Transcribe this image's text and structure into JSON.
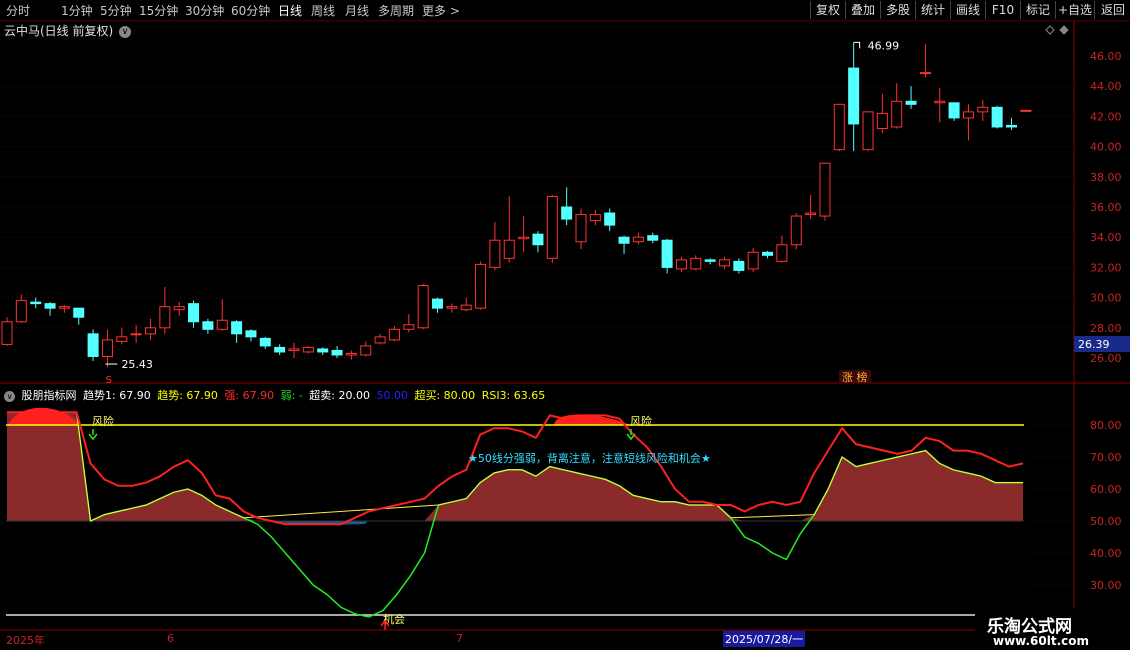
{
  "toolbar": {
    "periods": [
      "分时",
      "1分钟",
      "5分钟",
      "15分钟",
      "30分钟",
      "60分钟",
      "日线",
      "周线",
      "月线",
      "多周期",
      "更多 >"
    ],
    "active_period": "日线",
    "buttons": [
      "复权",
      "叠加",
      "多股",
      "统计",
      "画线",
      "F10",
      "标记",
      "+自选",
      "返回"
    ]
  },
  "main_chart": {
    "title": "云中马(日线 前复权)",
    "high_label": "46.99",
    "low_label": "25.43",
    "price_tag": "26.39",
    "limit_up_tag": "涨 榜",
    "y_ticks": [
      "46.00",
      "44.00",
      "42.00",
      "40.00",
      "38.00",
      "36.00",
      "34.00",
      "32.00",
      "30.00",
      "28.00",
      "26.00"
    ],
    "s_marker": "S"
  },
  "indicator": {
    "name": "股朋指标网",
    "values": [
      {
        "label": "趋势1: 67.90",
        "color": "#ffffff"
      },
      {
        "label": "趋势: 67.90",
        "color": "#ffff00"
      },
      {
        "label": "强: 67.90",
        "color": "#ff2a2a"
      },
      {
        "label": "弱: -",
        "color": "#22dd22"
      },
      {
        "label": "超卖: 20.00",
        "color": "#ffffff"
      },
      {
        "label": "50.00",
        "color": "#2222ff"
      },
      {
        "label": "超买: 80.00",
        "color": "#ffff00"
      },
      {
        "label": "RSI3: 63.65",
        "color": "#ffff00"
      }
    ],
    "y_ticks": [
      "80.00",
      "70.00",
      "60.00",
      "50.00",
      "40.00",
      "30.00"
    ],
    "annotation": "★50线分强弱，背离注意，注意短线风险和机会★",
    "risk_label": "风险",
    "chance_label": "机会"
  },
  "date_axis": {
    "labels": [
      "2025年",
      "6",
      "7"
    ],
    "cursor_date": "2025/07/28/一"
  },
  "watermark": {
    "site": "乐淘公式网",
    "url": "www.60lt.com"
  },
  "chart_data": {
    "type": "candlestick",
    "ylim": [
      25,
      47.5
    ],
    "up_color": "#ff3232",
    "down_color": "#54ffff",
    "candles": [
      [
        26.9,
        28.4,
        26.8,
        28.7
      ],
      [
        28.4,
        29.8,
        28.3,
        30.2
      ],
      [
        29.7,
        29.6,
        29.3,
        30.0
      ],
      [
        29.6,
        29.3,
        28.8,
        29.7
      ],
      [
        29.3,
        29.4,
        29.0,
        29.5
      ],
      [
        29.3,
        28.7,
        28.2,
        29.0
      ],
      [
        27.6,
        26.1,
        25.8,
        27.9
      ],
      [
        26.1,
        27.2,
        25.4,
        27.9
      ],
      [
        27.1,
        27.4,
        26.9,
        28.0
      ],
      [
        27.6,
        27.6,
        27.0,
        28.2
      ],
      [
        27.6,
        28.0,
        27.2,
        28.6
      ],
      [
        28.0,
        29.4,
        27.6,
        30.7
      ],
      [
        29.2,
        29.4,
        28.8,
        29.7
      ],
      [
        29.6,
        28.4,
        28.0,
        29.8
      ],
      [
        28.4,
        27.9,
        27.6,
        28.6
      ],
      [
        27.9,
        28.5,
        27.8,
        29.9
      ],
      [
        28.4,
        27.6,
        27.0,
        28.5
      ],
      [
        27.8,
        27.4,
        27.1,
        27.9
      ],
      [
        27.3,
        26.8,
        26.6,
        27.4
      ],
      [
        26.7,
        26.4,
        26.2,
        26.9
      ],
      [
        26.5,
        26.6,
        26.0,
        27.0
      ],
      [
        26.4,
        26.7,
        26.3,
        26.8
      ],
      [
        26.6,
        26.4,
        26.2,
        26.7
      ],
      [
        26.5,
        26.2,
        26.0,
        26.8
      ],
      [
        26.2,
        26.3,
        25.9,
        26.5
      ],
      [
        26.2,
        26.8,
        26.1,
        27.1
      ],
      [
        27.0,
        27.4,
        26.9,
        27.6
      ],
      [
        27.2,
        27.9,
        27.1,
        28.1
      ],
      [
        27.9,
        28.2,
        27.7,
        28.9
      ],
      [
        28.0,
        30.8,
        27.9,
        30.9
      ],
      [
        29.9,
        29.3,
        29.0,
        30.0
      ],
      [
        29.3,
        29.4,
        29.0,
        29.6
      ],
      [
        29.2,
        29.5,
        29.1,
        30.0
      ],
      [
        29.3,
        32.2,
        29.2,
        32.4
      ],
      [
        32.0,
        33.8,
        31.8,
        35.0
      ],
      [
        32.6,
        33.8,
        32.3,
        36.7
      ],
      [
        33.9,
        34.0,
        33.0,
        35.4
      ],
      [
        34.2,
        33.5,
        33.0,
        34.4
      ],
      [
        32.6,
        36.7,
        32.3,
        36.8
      ],
      [
        36.0,
        35.2,
        34.8,
        37.3
      ],
      [
        33.7,
        35.5,
        33.2,
        35.9
      ],
      [
        35.1,
        35.5,
        34.8,
        35.8
      ],
      [
        35.6,
        34.8,
        34.4,
        35.9
      ],
      [
        34.0,
        33.6,
        32.9,
        34.1
      ],
      [
        33.7,
        34.0,
        33.5,
        34.3
      ],
      [
        34.1,
        33.8,
        33.6,
        34.3
      ],
      [
        33.8,
        32.0,
        31.6,
        33.9
      ],
      [
        31.9,
        32.5,
        31.7,
        32.7
      ],
      [
        31.9,
        32.6,
        31.8,
        32.8
      ],
      [
        32.5,
        32.4,
        32.2,
        32.6
      ],
      [
        32.1,
        32.5,
        31.9,
        32.7
      ],
      [
        32.4,
        31.8,
        31.6,
        32.6
      ],
      [
        31.9,
        33.0,
        31.7,
        33.3
      ],
      [
        33.0,
        32.8,
        32.6,
        33.1
      ],
      [
        32.4,
        33.5,
        32.3,
        34.1
      ],
      [
        33.5,
        35.4,
        33.2,
        35.6
      ],
      [
        35.5,
        35.6,
        35.2,
        36.8
      ],
      [
        35.4,
        38.9,
        35.1,
        38.9
      ],
      [
        39.8,
        42.8,
        39.7,
        42.8
      ],
      [
        45.2,
        41.5,
        39.7,
        46.9
      ],
      [
        39.8,
        42.3,
        39.7,
        42.3
      ],
      [
        41.2,
        42.2,
        40.9,
        43.5
      ],
      [
        41.3,
        43.0,
        41.2,
        44.2
      ],
      [
        43.0,
        42.8,
        42.5,
        44.0
      ],
      [
        44.9,
        44.9,
        44.6,
        46.8
      ],
      [
        42.9,
        43.0,
        41.6,
        43.9
      ],
      [
        42.9,
        41.9,
        41.7,
        42.2
      ],
      [
        41.9,
        42.3,
        40.4,
        42.8
      ],
      [
        42.3,
        42.6,
        41.7,
        43.1
      ],
      [
        42.6,
        41.3,
        41.2,
        42.7
      ],
      [
        41.4,
        41.3,
        41.1,
        41.9
      ],
      [
        42.4,
        42.4,
        42.4,
        42.4
      ]
    ],
    "oscillator": {
      "ylim": [
        20,
        90
      ],
      "red_line": [
        84,
        84,
        84,
        84,
        84,
        84,
        68,
        63,
        61,
        61,
        62,
        64,
        67,
        69,
        65,
        58,
        57,
        53,
        51,
        50,
        49,
        49,
        49,
        49,
        49,
        51,
        53,
        54,
        55,
        56,
        57,
        61,
        64,
        66,
        77,
        79,
        79,
        78,
        76,
        83,
        82,
        83,
        83,
        83,
        82,
        77,
        73,
        67,
        60,
        56,
        56,
        55,
        55,
        53,
        55,
        56,
        55,
        56,
        65,
        72,
        79,
        74,
        73,
        72,
        71,
        72,
        76,
        75,
        72,
        72,
        71,
        69,
        67,
        68
      ],
      "green_line": [
        84,
        84,
        84,
        84,
        84,
        84,
        50,
        52,
        53,
        54,
        55,
        57,
        59,
        60,
        58,
        55,
        53,
        51,
        49,
        45,
        40,
        35,
        30,
        27,
        23,
        21,
        20,
        22,
        27,
        33,
        40,
        55,
        56,
        57,
        62,
        65,
        66,
        66,
        64,
        67,
        66,
        65,
        64,
        63,
        61,
        58,
        57,
        56,
        56,
        55,
        55,
        55,
        51,
        45,
        43,
        40,
        38,
        46,
        52,
        60,
        70,
        67,
        68,
        69,
        70,
        71,
        72,
        68,
        66,
        65,
        64,
        62,
        62,
        62
      ]
    }
  }
}
